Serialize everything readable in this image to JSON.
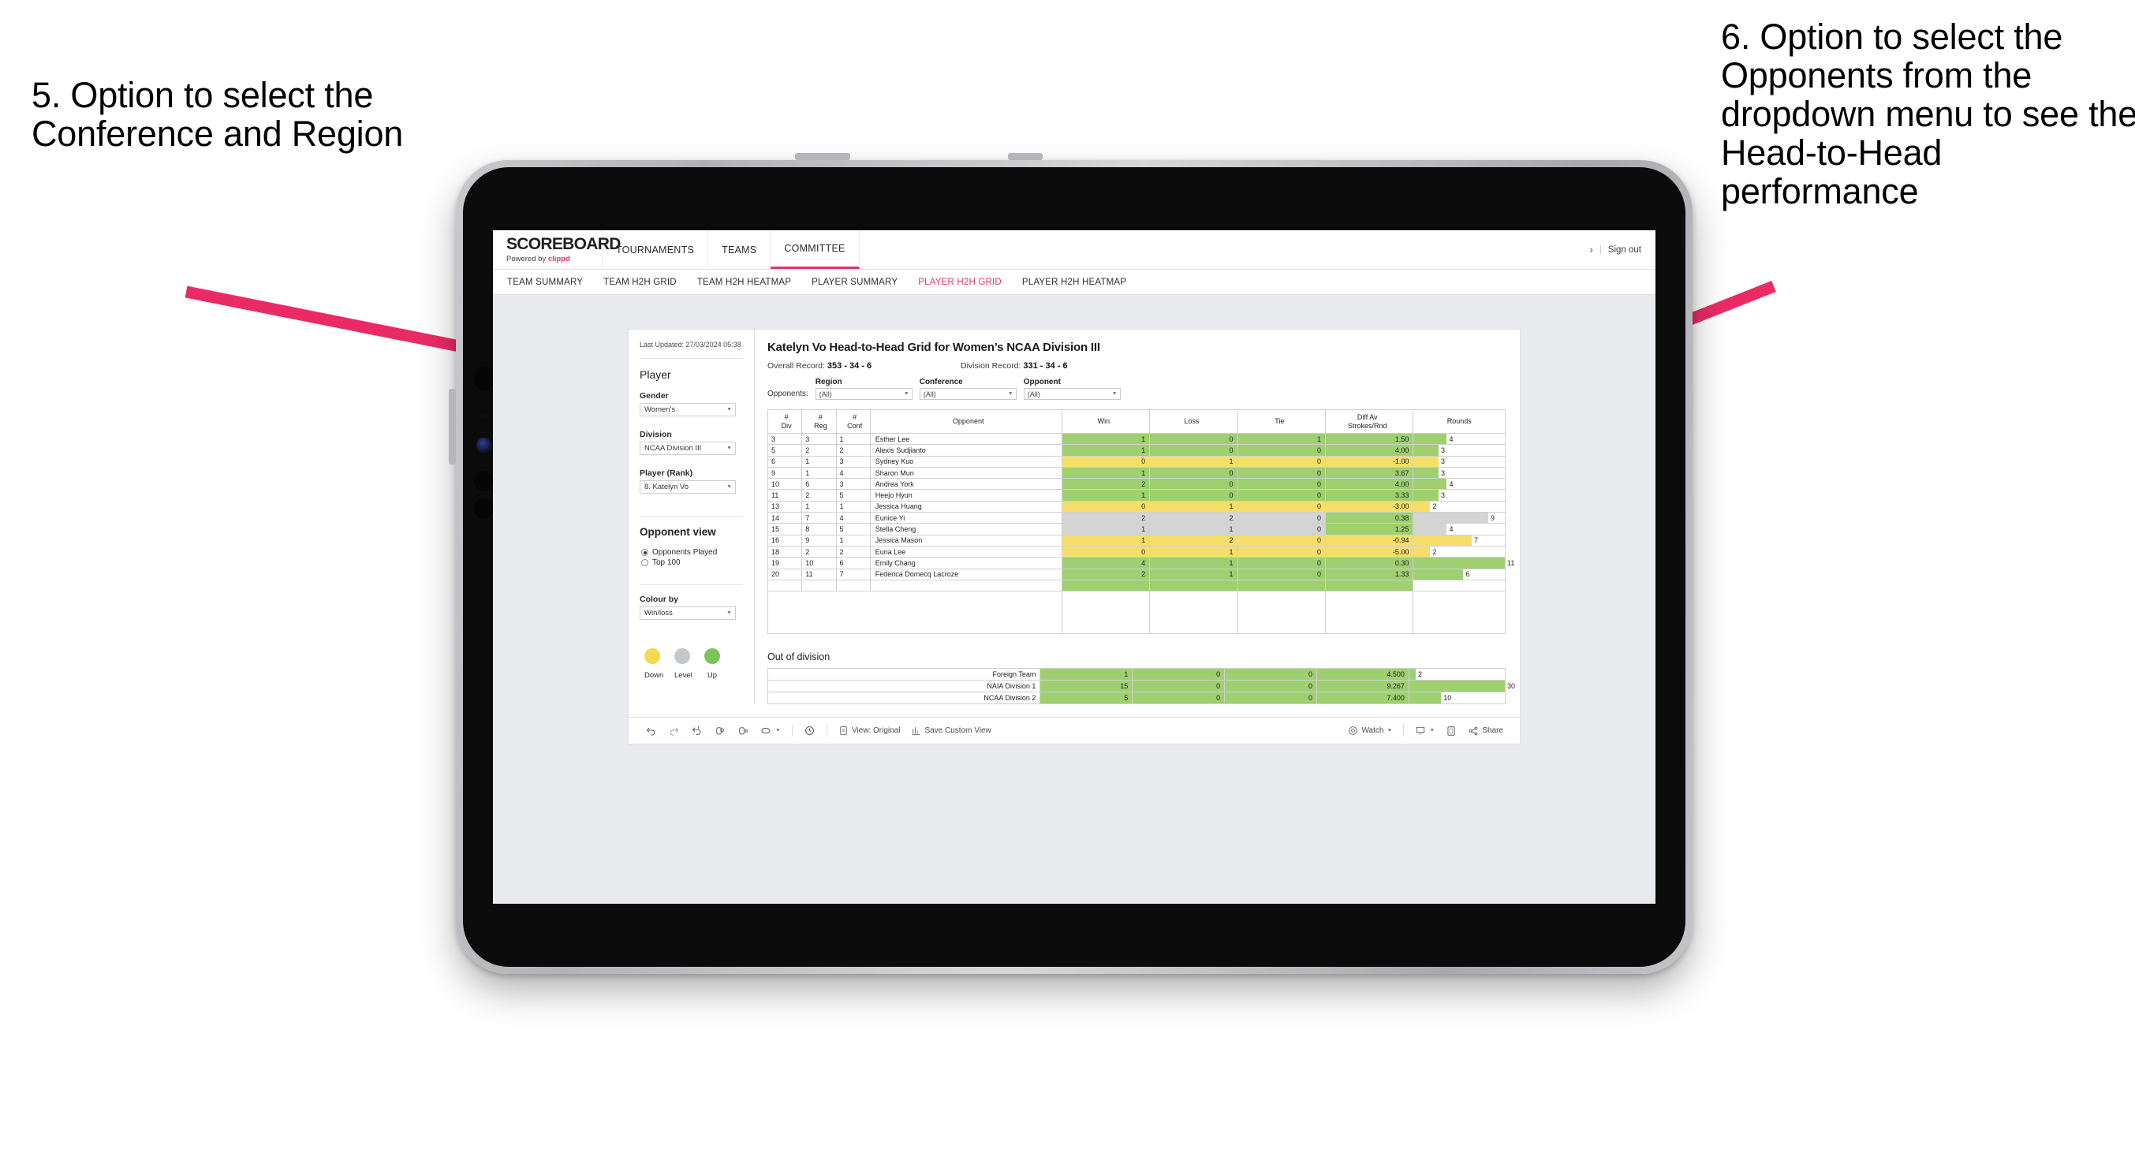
{
  "annotations": {
    "left": "5. Option to select the Conference and Region",
    "right": "6. Option to select the Opponents from the dropdown menu to see the Head-to-Head performance",
    "arrow_color": "#ea2b63"
  },
  "topnav": {
    "brand_title": "SCOREBOARD",
    "brand_powered": "Powered by ",
    "brand_name": "clippd",
    "items": [
      {
        "label": "TOURNAMENTS",
        "active": false
      },
      {
        "label": "TEAMS",
        "active": false
      },
      {
        "label": "COMMITTEE",
        "active": true
      }
    ],
    "kebab": "›",
    "separator": "|",
    "signout": "Sign out"
  },
  "subnav": {
    "items": [
      {
        "label": "TEAM SUMMARY",
        "active": false
      },
      {
        "label": "TEAM H2H GRID",
        "active": false
      },
      {
        "label": "TEAM H2H HEATMAP",
        "active": false
      },
      {
        "label": "PLAYER SUMMARY",
        "active": false
      },
      {
        "label": "PLAYER H2H GRID",
        "active": true
      },
      {
        "label": "PLAYER H2H HEATMAP",
        "active": false
      }
    ]
  },
  "rail": {
    "last_updated": "Last Updated: 27/03/2024 05:38",
    "player_heading": "Player",
    "gender_label": "Gender",
    "gender_value": "Women's",
    "division_label": "Division",
    "division_value": "NCAA Division III",
    "player_rank_label": "Player (Rank)",
    "player_rank_value": "8. Katelyn Vo",
    "opponent_view_heading": "Opponent view",
    "opponent_view_options": [
      {
        "label": "Opponents Played",
        "selected": true
      },
      {
        "label": "Top 100",
        "selected": false
      }
    ],
    "colour_by_label": "Colour by",
    "colour_by_value": "Win/loss",
    "legend": [
      {
        "label": "Down",
        "color": "#f2d94e"
      },
      {
        "label": "Level",
        "color": "#c4c8cc"
      },
      {
        "label": "Up",
        "color": "#7cc45a"
      }
    ]
  },
  "main": {
    "title": "Katelyn Vo Head-to-Head Grid for Women’s NCAA Division III",
    "overall_record_label": "Overall Record: ",
    "overall_record_value": "353 - 34 - 6",
    "division_record_label": "Division Record: ",
    "division_record_value": "331 - 34 - 6",
    "opponents_label": "Opponents:",
    "filters": [
      {
        "label": "Region",
        "value": "(All)"
      },
      {
        "label": "Conference",
        "value": "(All)"
      },
      {
        "label": "Opponent",
        "value": "(All)"
      }
    ]
  },
  "chart_data": {
    "type": "table",
    "title": "Katelyn Vo Head-to-Head Grid for Women’s NCAA Division III",
    "columns": [
      "# Div",
      "# Reg",
      "# Conf",
      "Opponent",
      "Win",
      "Loss",
      "Tie",
      "Diff Av Strokes/Rnd",
      "Rounds"
    ],
    "column_headers_multiline": [
      {
        "l1": "#",
        "l2": "Div"
      },
      {
        "l1": "#",
        "l2": "Reg"
      },
      {
        "l1": "#",
        "l2": "Conf"
      },
      {
        "l1": "Opponent",
        "l2": ""
      },
      {
        "l1": "Win",
        "l2": ""
      },
      {
        "l1": "Loss",
        "l2": ""
      },
      {
        "l1": "Tie",
        "l2": ""
      },
      {
        "l1": "Diff Av",
        "l2": "Strokes/Rnd"
      },
      {
        "l1": "Rounds",
        "l2": ""
      }
    ],
    "rounds_max": 11,
    "rows": [
      {
        "div": "3",
        "reg": "3",
        "conf": "1",
        "opponent": "Esther Lee",
        "win": "1",
        "loss": "0",
        "tie": "1",
        "diff": "1.50",
        "rounds": "4",
        "state": "up"
      },
      {
        "div": "5",
        "reg": "2",
        "conf": "2",
        "opponent": "Alexis Sudjianto",
        "win": "1",
        "loss": "0",
        "tie": "0",
        "diff": "4.00",
        "rounds": "3",
        "state": "up"
      },
      {
        "div": "6",
        "reg": "1",
        "conf": "3",
        "opponent": "Sydney Kuo",
        "win": "0",
        "loss": "1",
        "tie": "0",
        "diff": "-1.00",
        "rounds": "3",
        "state": "down"
      },
      {
        "div": "9",
        "reg": "1",
        "conf": "4",
        "opponent": "Sharon Mun",
        "win": "1",
        "loss": "0",
        "tie": "0",
        "diff": "3.67",
        "rounds": "3",
        "state": "up"
      },
      {
        "div": "10",
        "reg": "6",
        "conf": "3",
        "opponent": "Andrea York",
        "win": "2",
        "loss": "0",
        "tie": "0",
        "diff": "4.00",
        "rounds": "4",
        "state": "up"
      },
      {
        "div": "11",
        "reg": "2",
        "conf": "5",
        "opponent": "Heejo Hyun",
        "win": "1",
        "loss": "0",
        "tie": "0",
        "diff": "3.33",
        "rounds": "3",
        "state": "up"
      },
      {
        "div": "13",
        "reg": "1",
        "conf": "1",
        "opponent": "Jessica Huang",
        "win": "0",
        "loss": "1",
        "tie": "0",
        "diff": "-3.00",
        "rounds": "2",
        "state": "down"
      },
      {
        "div": "14",
        "reg": "7",
        "conf": "4",
        "opponent": "Eunice Yi",
        "win": "2",
        "loss": "2",
        "tie": "0",
        "diff": "0.38",
        "rounds": "9",
        "state": "level",
        "diff_state": "up"
      },
      {
        "div": "15",
        "reg": "8",
        "conf": "5",
        "opponent": "Stella Cheng",
        "win": "1",
        "loss": "1",
        "tie": "0",
        "diff": "1.25",
        "rounds": "4",
        "state": "level",
        "diff_state": "up"
      },
      {
        "div": "16",
        "reg": "9",
        "conf": "1",
        "opponent": "Jessica Mason",
        "win": "1",
        "loss": "2",
        "tie": "0",
        "diff": "-0.94",
        "rounds": "7",
        "state": "down"
      },
      {
        "div": "18",
        "reg": "2",
        "conf": "2",
        "opponent": "Euna Lee",
        "win": "0",
        "loss": "1",
        "tie": "0",
        "diff": "-5.00",
        "rounds": "2",
        "state": "down"
      },
      {
        "div": "19",
        "reg": "10",
        "conf": "6",
        "opponent": "Emily Chang",
        "win": "4",
        "loss": "1",
        "tie": "0",
        "diff": "0.30",
        "rounds": "11",
        "state": "up"
      },
      {
        "div": "20",
        "reg": "11",
        "conf": "7",
        "opponent": "Federica Domecq Lacroze",
        "win": "2",
        "loss": "1",
        "tie": "0",
        "diff": "1.33",
        "rounds": "6",
        "state": "up"
      }
    ],
    "out_of_division_title": "Out of division",
    "out_of_division_rounds_max": 30,
    "out_of_division": [
      {
        "name": "Foreign Team",
        "win": "1",
        "loss": "0",
        "tie": "0",
        "diff": "4.500",
        "rounds": "2",
        "state": "up"
      },
      {
        "name": "NAIA Division 1",
        "win": "15",
        "loss": "0",
        "tie": "0",
        "diff": "9.267",
        "rounds": "30",
        "state": "up"
      },
      {
        "name": "NCAA Division 2",
        "win": "5",
        "loss": "0",
        "tie": "0",
        "diff": "7.400",
        "rounds": "10",
        "state": "up"
      }
    ]
  },
  "toolbar": {
    "view_label": "View: Original",
    "save_label": "Save Custom View",
    "watch_label": "Watch",
    "share_label": "Share"
  }
}
